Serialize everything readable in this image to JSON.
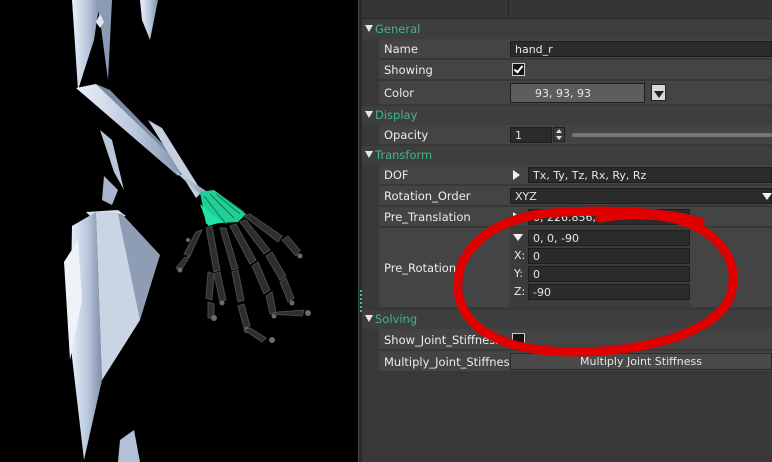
{
  "sections": {
    "general": "General",
    "display": "Display",
    "transform": "Transform",
    "solving": "Solving"
  },
  "general": {
    "name_label": "Name",
    "name_value": "hand_r",
    "showing_label": "Showing",
    "showing_checked": true,
    "color_label": "Color",
    "color_value": "93, 93, 93",
    "color_swatch": "#5d5d5d"
  },
  "display": {
    "opacity_label": "Opacity",
    "opacity_value": "1"
  },
  "transform": {
    "dof_label": "DOF",
    "dof_value": "Tx, Ty, Tz, Rx, Ry, Rz",
    "rotation_order_label": "Rotation_Order",
    "rotation_order_value": "XYZ",
    "pre_translation_label": "Pre_Translation",
    "pre_translation_value": "0, 226.856, 90",
    "pre_rotation_label": "Pre_Rotation",
    "pre_rotation_value": "0, 0, -90",
    "x_label": "X:",
    "x_value": "0",
    "y_label": "Y:",
    "y_value": "0",
    "z_label": "Z:",
    "z_value": "-90"
  },
  "solving": {
    "show_joint_stiffness_label": "Show_Joint_Stiffness",
    "show_joint_stiffness_checked": false,
    "multiply_joint_stiffness_label": "Multiply_Joint_Stiffness",
    "multiply_joint_stiffness_button": "Multiply Joint Stiffness"
  },
  "colors": {
    "accent": "#3fb882",
    "bone": "#c8d4e4",
    "selected_bone": "#1fcf96",
    "annotation": "#e00000"
  }
}
